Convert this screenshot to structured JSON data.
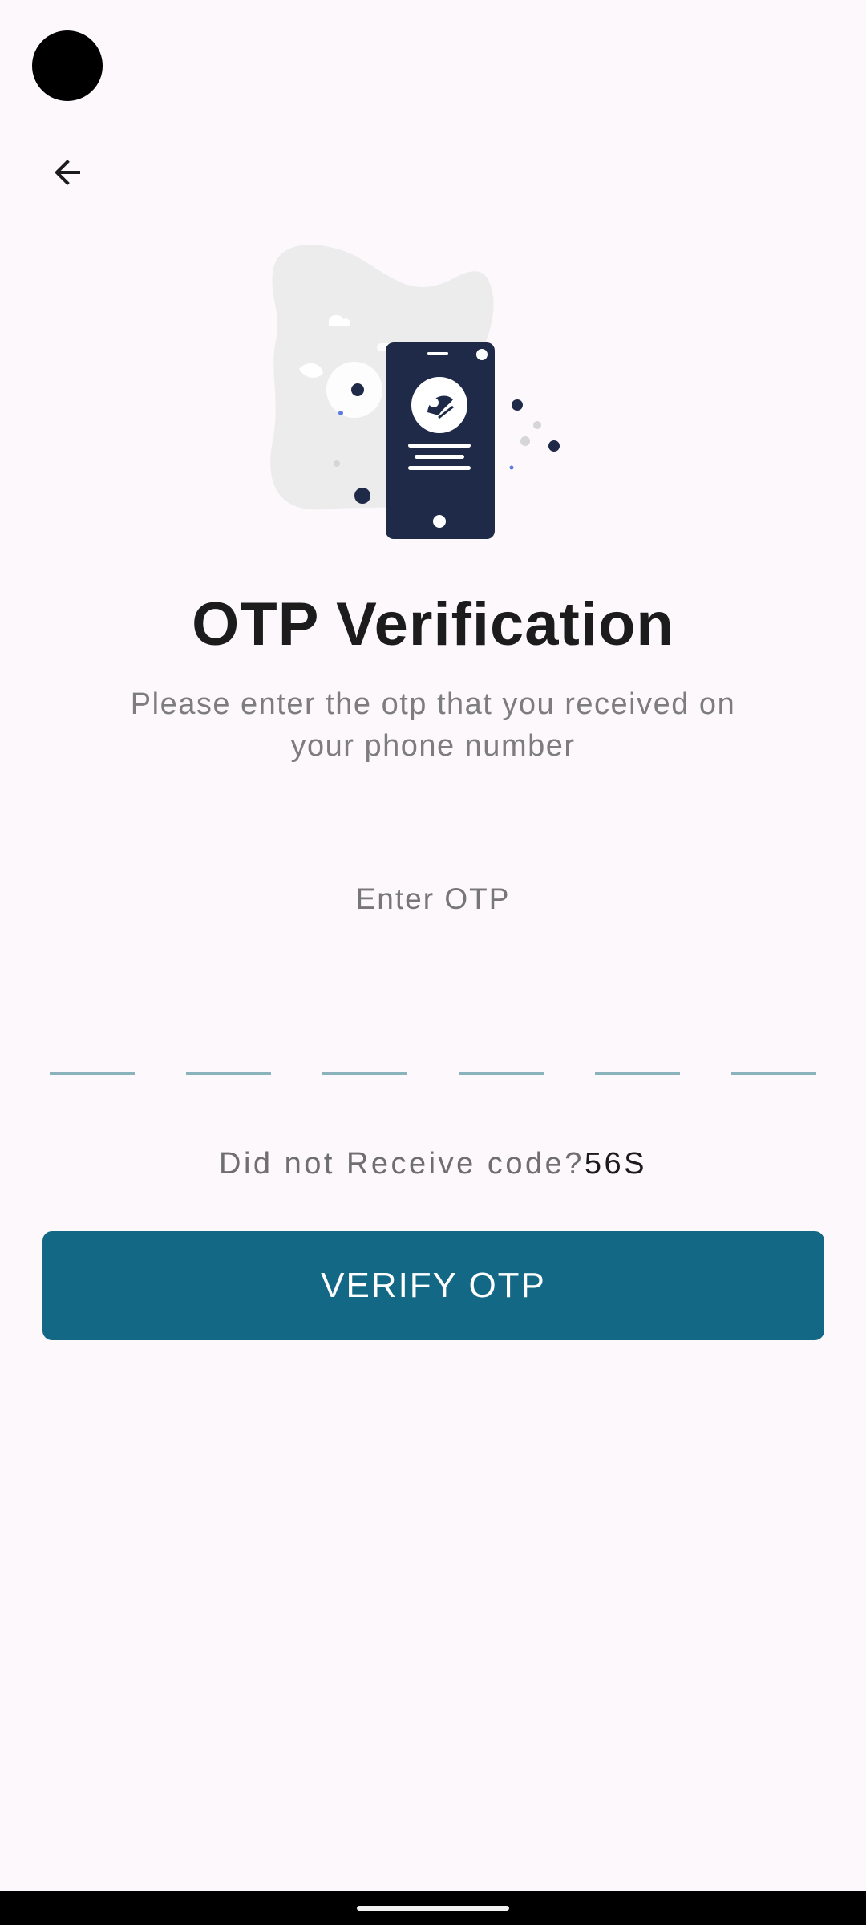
{
  "header": {
    "back_icon": "arrow-left-icon"
  },
  "illustration": {
    "icon": "phone-otp-illustration",
    "colors": {
      "phone": "#1f2a48",
      "blob": "#ececec"
    }
  },
  "main": {
    "title": "OTP Verification",
    "subtitle": "Please enter the otp that you received on your phone number",
    "otp_label": "Enter OTP",
    "otp_length": 6,
    "otp_values": [
      "",
      "",
      "",
      "",
      "",
      ""
    ]
  },
  "resend": {
    "text": "Did not Receive code?",
    "timer": "56S"
  },
  "verify": {
    "label": "VERIFY OTP",
    "color": "#136885"
  }
}
